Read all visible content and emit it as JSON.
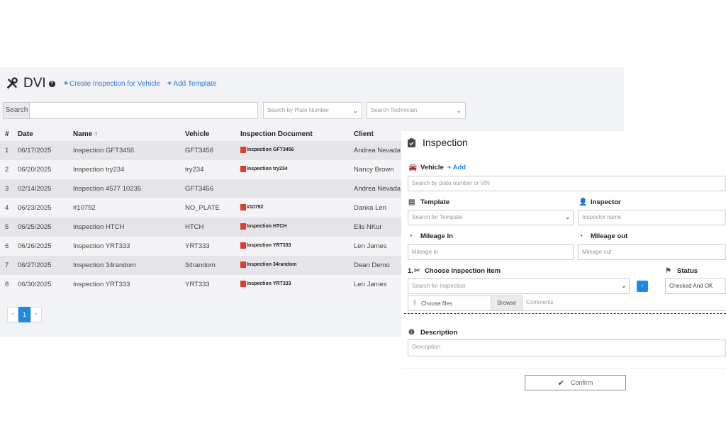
{
  "header": {
    "title": "DVI",
    "create_link": "Create Inspection for Vehicle",
    "add_template_link": "Add Template"
  },
  "search": {
    "label": "Search",
    "plate_placeholder": "Search by Plate Number",
    "tech_placeholder": "Search Technician"
  },
  "table": {
    "headers": [
      "#",
      "Date",
      "Name ↑",
      "Vehicle",
      "Inspection Document",
      "Client"
    ],
    "rows": [
      {
        "num": "1",
        "date": "06/17/2025",
        "name": "Inspection GFT3456",
        "vehicle": "GFT3456",
        "doc": "Inspection GFT3456",
        "client": "Andrea Nevada"
      },
      {
        "num": "2",
        "date": "06/20/2025",
        "name": "Inspection try234",
        "vehicle": "try234",
        "doc": "Inspection try234",
        "client": "Nancy Brown"
      },
      {
        "num": "3",
        "date": "02/14/2025",
        "name": "Inspection 4577 10235",
        "vehicle": "GFT3456",
        "doc": "",
        "client": "Andrea Nevada"
      },
      {
        "num": "4",
        "date": "06/23/2025",
        "name": "#10792",
        "vehicle": "NO_PLATE",
        "doc": "#10792",
        "client": "Danka Len"
      },
      {
        "num": "5",
        "date": "06/25/2025",
        "name": "Inspection HTCH",
        "vehicle": "HTCH",
        "doc": "Inspection HTCH",
        "client": "Elis NKur"
      },
      {
        "num": "6",
        "date": "06/26/2025",
        "name": "Inspection YRT333",
        "vehicle": "YRT333",
        "doc": "Inspection YRT333",
        "client": "Len James"
      },
      {
        "num": "7",
        "date": "06/27/2025",
        "name": "Inspection 34random",
        "vehicle": "34random",
        "doc": "Inspection 34random",
        "client": "Dean Demo"
      },
      {
        "num": "8",
        "date": "06/30/2025",
        "name": "Inspection YRT333",
        "vehicle": "YRT333",
        "doc": "Inspection YRT333",
        "client": "Len James"
      }
    ]
  },
  "pagination": {
    "prev": "«",
    "current": "1",
    "next": "»"
  },
  "panel": {
    "title": "Inspection",
    "vehicle_label": "Vehicle",
    "vehicle_add": "+ Add",
    "vehicle_placeholder": "Search by plate number or VIN",
    "template_label": "Template",
    "template_placeholder": "Search for Template",
    "inspector_label": "Inspector",
    "inspector_placeholder": "Inspector name",
    "mileage_in_label": "Mileage In",
    "mileage_in_placeholder": "Mileage In",
    "mileage_out_label": "Mileage out",
    "mileage_out_placeholder": "Mileage out",
    "item_label": "1.",
    "item_title": "Choose Inspection Item",
    "item_placeholder": "Search for Inspection",
    "status_label": "Status",
    "status_value": "Checked And OK",
    "choose_files": "Choose files",
    "browse": "Browse",
    "comments_placeholder": "Comments",
    "description_label": "Description",
    "description_placeholder": "Description",
    "confirm": "Confirm"
  },
  "icons": [
    "tools-icon",
    "help-icon",
    "pdf-icon",
    "clipboard-icon",
    "car-icon",
    "template-icon",
    "user-icon",
    "gauge-icon",
    "tools-icon",
    "flag-icon",
    "upload-icon",
    "info-icon",
    "check-icon"
  ],
  "colors": {
    "accent": "#1e88e5",
    "link": "#2f7bd9",
    "pdf": "#e03b2d"
  }
}
